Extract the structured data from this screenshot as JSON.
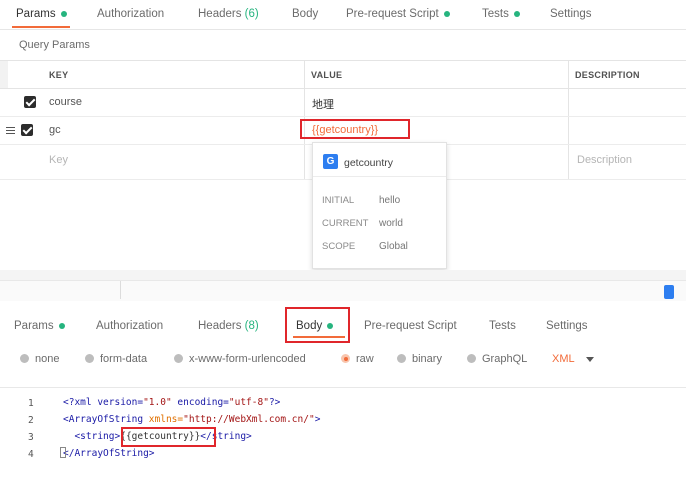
{
  "top_tabs": [
    {
      "label": "Params",
      "dot": true,
      "count": ""
    },
    {
      "label": "Authorization",
      "dot": false,
      "count": ""
    },
    {
      "label": "Headers",
      "dot": false,
      "count": "(6)"
    },
    {
      "label": "Body",
      "dot": false,
      "count": ""
    },
    {
      "label": "Pre-request Script",
      "dot": true,
      "count": ""
    },
    {
      "label": "Tests",
      "dot": true,
      "count": ""
    },
    {
      "label": "Settings",
      "dot": false,
      "count": ""
    }
  ],
  "section_title": "Query Params",
  "table": {
    "headers": {
      "key": "KEY",
      "value": "VALUE",
      "description": "DESCRIPTION"
    },
    "rows": [
      {
        "key": "course",
        "value": "地理"
      },
      {
        "key": "gc",
        "value": "{{getcountry}}"
      }
    ],
    "new_row": {
      "key_placeholder": "Key",
      "description_placeholder": "Description"
    }
  },
  "variable_popup": {
    "badge": "G",
    "name": "getcountry",
    "rows": [
      {
        "label": "INITIAL",
        "value": "hello"
      },
      {
        "label": "CURRENT",
        "value": "world"
      },
      {
        "label": "SCOPE",
        "value": "Global"
      }
    ]
  },
  "bottom_tabs": [
    {
      "label": "Params",
      "dot": true,
      "count": ""
    },
    {
      "label": "Authorization",
      "dot": false,
      "count": ""
    },
    {
      "label": "Headers",
      "dot": false,
      "count": "(8)"
    },
    {
      "label": "Body",
      "dot": true,
      "count": ""
    },
    {
      "label": "Pre-request Script",
      "dot": false,
      "count": ""
    },
    {
      "label": "Tests",
      "dot": false,
      "count": ""
    },
    {
      "label": "Settings",
      "dot": false,
      "count": ""
    }
  ],
  "body_modes": [
    {
      "label": "none",
      "selected": false
    },
    {
      "label": "form-data",
      "selected": false
    },
    {
      "label": "x-www-form-urlencoded",
      "selected": false
    },
    {
      "label": "raw",
      "selected": true
    },
    {
      "label": "binary",
      "selected": false
    },
    {
      "label": "GraphQL",
      "selected": false
    }
  ],
  "raw_format": "XML",
  "editor": {
    "line_numbers": [
      "1",
      "2",
      "3",
      "4"
    ],
    "lines": {
      "l1_open": "<?xml version=",
      "l1_version": "\"1.0\"",
      "l1_mid": " encoding=",
      "l1_encoding": "\"utf-8\"",
      "l1_close": "?>",
      "l2_open": "<ArrayOfString ",
      "l2_attr": "xmlns=",
      "l2_ns": "\"http://WebXml.com.cn/\"",
      "l2_close": ">",
      "l3_indent": "  ",
      "l3_open": "<string>",
      "l3_var": "{{getcountry}}",
      "l3_close": "</string>",
      "l4": "</ArrayOfString>"
    }
  },
  "colors": {
    "accent": "#f26b3a",
    "dot_green": "#26b47f",
    "highlight_red": "#e0262b",
    "badge_blue": "#2d7ef0"
  }
}
